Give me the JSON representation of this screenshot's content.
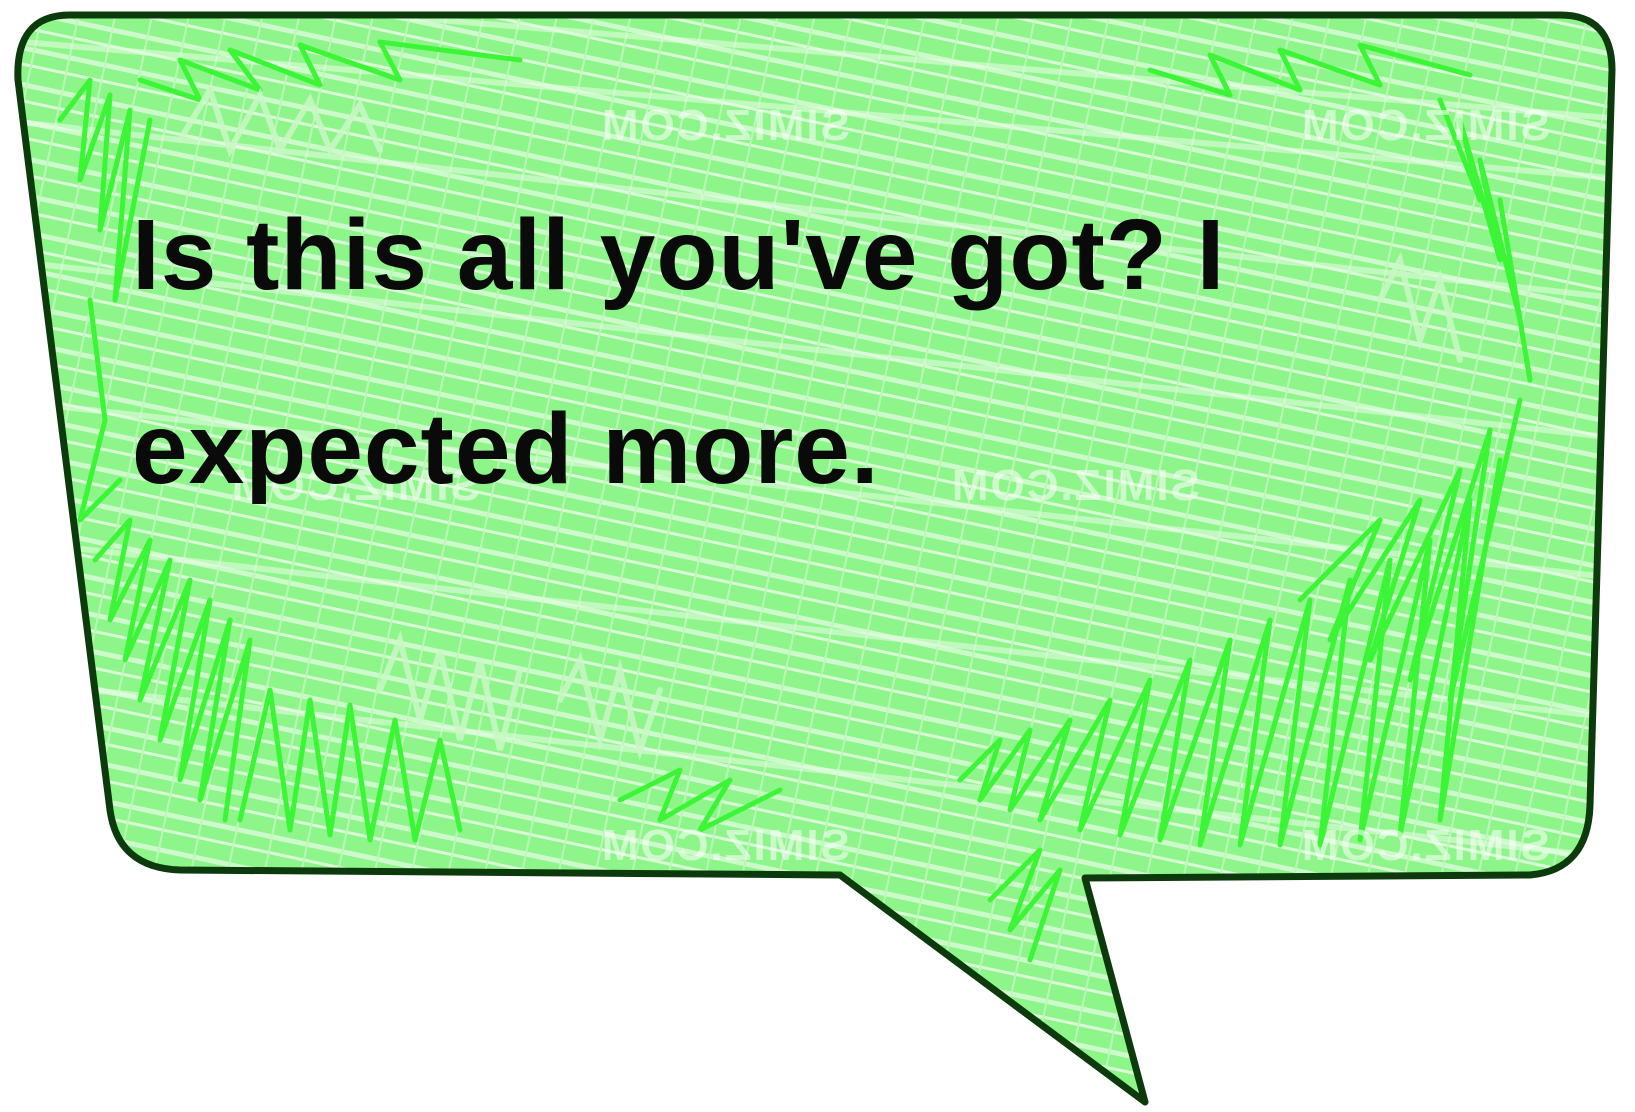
{
  "bubble": {
    "line1": "Is this all you've got? I",
    "line2": "expected more."
  },
  "colors": {
    "fill": "#8ef58a",
    "hatch_light": "#d8fbd6",
    "scribble": "#3cf536",
    "scribble_soft": "#c9f7c6",
    "outline": "#0d3a0d",
    "text": "#0a0a0a"
  },
  "watermark": {
    "text": "SIMIZ.COM"
  }
}
